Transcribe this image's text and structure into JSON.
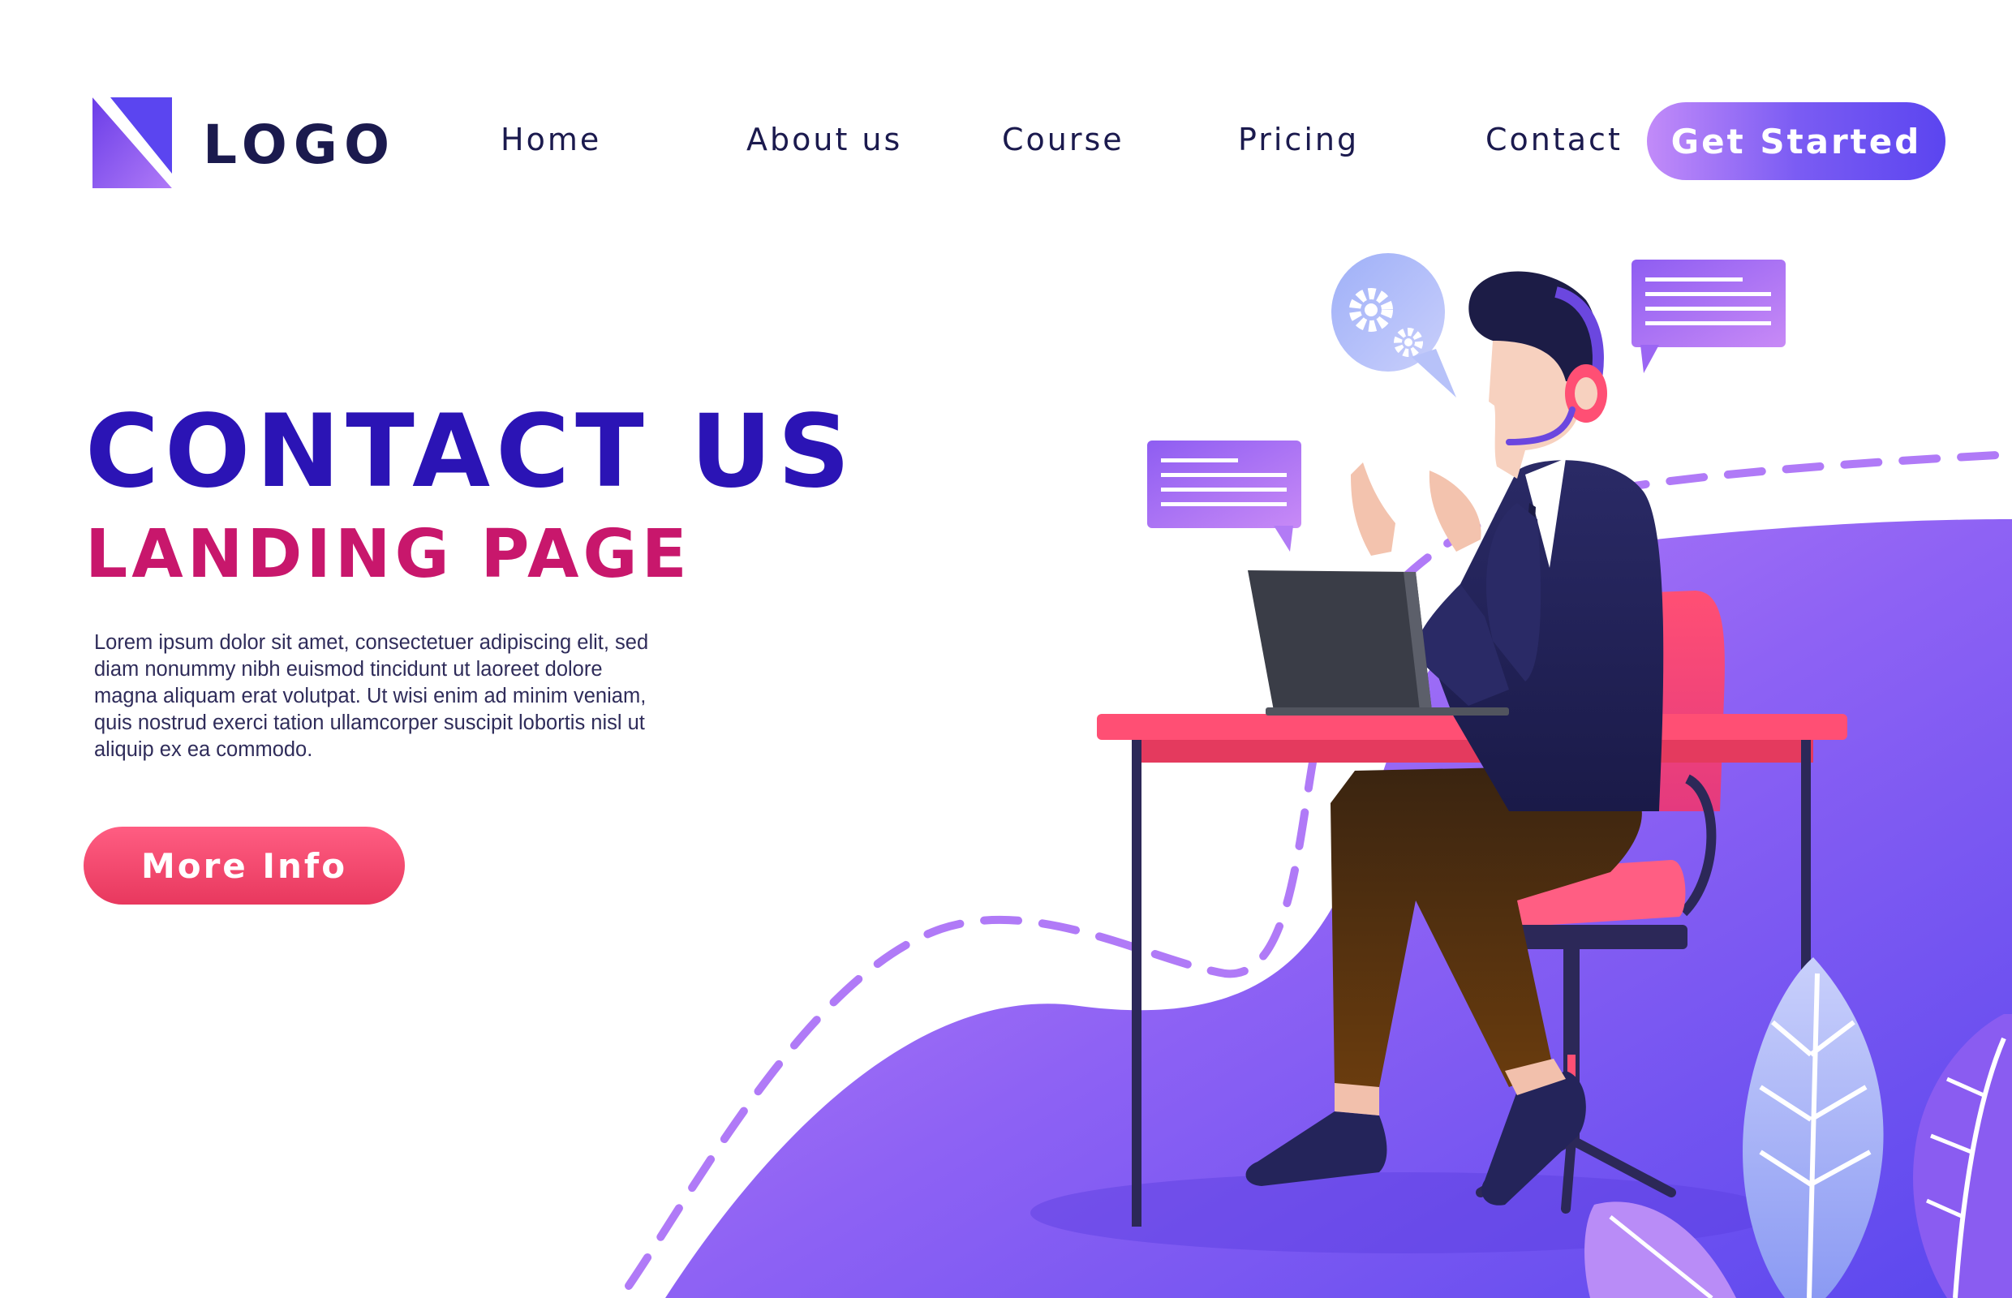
{
  "header": {
    "logo_text": "LOGO",
    "nav": [
      "Home",
      "About us",
      "Course",
      "Pricing",
      "Contact"
    ],
    "cta_label": "Get Started"
  },
  "hero": {
    "title": "CONTACT US",
    "subtitle": "LANDING PAGE",
    "body": "Lorem ipsum dolor sit amet, consectetuer adipiscing elit, sed diam nonummy nibh euismod tincidunt ut laoreet dolore magna aliquam erat volutpat. Ut wisi enim ad minim veniam, quis nostrud exerci tation ullamcorper suscipit lobortis nisl ut aliquip ex ea commodo.",
    "button_label": "More Info"
  },
  "icons": [
    "logo-mark-icon",
    "gear-icon",
    "chat-bubble-icon",
    "headset-icon",
    "laptop-icon",
    "leaf-icon"
  ],
  "colors": {
    "title": "#2b14b5",
    "subtitle": "#c8176c",
    "nav_text": "#1b1a4e",
    "accent_purple": "#7b5cf3",
    "accent_pink": "#ff4f74"
  }
}
